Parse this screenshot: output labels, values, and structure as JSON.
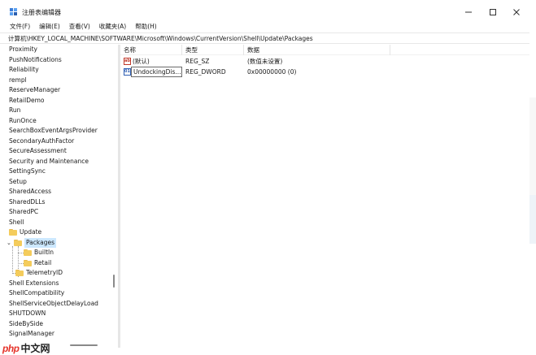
{
  "window": {
    "title": "注册表编辑器",
    "controls": {
      "minimize": "minimize-icon",
      "maximize": "maximize-icon",
      "close": "close-icon"
    }
  },
  "menu": [
    "文件(F)",
    "编辑(E)",
    "查看(V)",
    "收藏夹(A)",
    "帮助(H)"
  ],
  "address": "计算机\\HKEY_LOCAL_MACHINE\\SOFTWARE\\Microsoft\\Windows\\CurrentVersion\\Shell\\Update\\Packages",
  "tree": {
    "items": [
      "Proximity",
      "PushNotifications",
      "Reliability",
      "rempl",
      "ReserveManager",
      "RetailDemo",
      "Run",
      "RunOnce",
      "SearchBoxEventArgsProvider",
      "SecondaryAuthFactor",
      "SecureAssessment",
      "Security and Maintenance",
      "SettingSync",
      "Setup",
      "SharedAccess",
      "SharedDLLs",
      "SharedPC",
      "Shell",
      "Update",
      "Packages",
      "BuiltIn",
      "Retail",
      "TelemetryID",
      "Shell Extensions",
      "ShellCompatibility",
      "ShellServiceObjectDelayLoad",
      "SHUTDOWN",
      "SideBySide",
      "SignalManager"
    ],
    "selected": "Packages"
  },
  "list": {
    "columns": [
      "名称",
      "类型",
      "数据"
    ],
    "rows": [
      {
        "name": "(默认)",
        "type": "REG_SZ",
        "data": "(数值未设置)",
        "icon": "string-value-icon"
      },
      {
        "name": "UndockingDis...",
        "type": "REG_DWORD",
        "data": "0x00000000 (0)",
        "icon": "binary-value-icon"
      }
    ]
  },
  "watermark": {
    "logo": "php",
    "text": "中文网"
  },
  "colors": {
    "selection": "#cce8ff",
    "folder": "#f4cc5c",
    "watermark_red": "#e5342b"
  }
}
